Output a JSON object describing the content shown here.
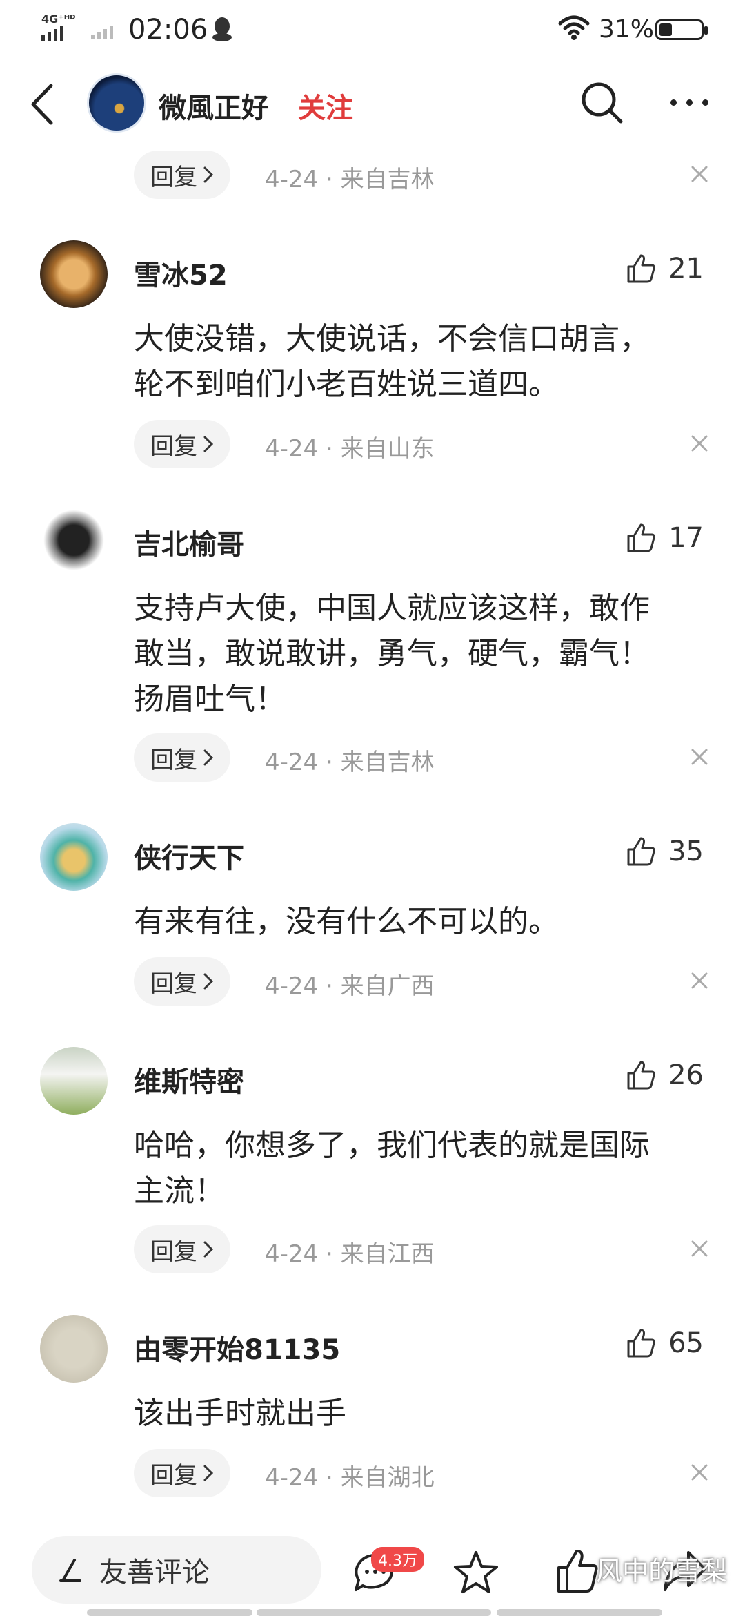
{
  "status_bar": {
    "network": "4G⁺ᴴᴰ",
    "time": "02:06",
    "battery": "31%",
    "battery_level": 0.31
  },
  "header": {
    "username": "微風正好",
    "follow_label": "关注"
  },
  "top_partial": {
    "reply_label": "回复",
    "meta": "4-24 · 来自吉林"
  },
  "comments": [
    {
      "user": "雪冰52",
      "likes": "21",
      "text": [
        "大使没错，大使说话，不会信口胡言，",
        "轮不到咱们小老百姓说三道四。"
      ],
      "reply_label": "回复",
      "meta": "4-24 · 来自山东"
    },
    {
      "user": "吉北榆哥",
      "likes": "17",
      "text": [
        "支持卢大使，中国人就应该这样，敢作",
        "敢当，敢说敢讲，勇气，硬气，霸气！",
        "扬眉吐气！"
      ],
      "reply_label": "回复",
      "meta": "4-24 · 来自吉林"
    },
    {
      "user": "侠行天下",
      "likes": "35",
      "text": [
        "有来有往，没有什么不可以的。"
      ],
      "reply_label": "回复",
      "meta": "4-24 · 来自广西"
    },
    {
      "user": "维斯特密",
      "likes": "26",
      "text": [
        "哈哈，你想多了，我们代表的就是国际",
        "主流！"
      ],
      "reply_label": "回复",
      "meta": "4-24 · 来自江西"
    },
    {
      "user": "由零开始81135",
      "likes": "65",
      "text": [
        "该出手时就出手"
      ],
      "reply_label": "回复",
      "meta": "4-24 · 来自湖北"
    }
  ],
  "bottom_bar": {
    "input_placeholder": "友善评论",
    "comment_count": "4.3万"
  },
  "watermark": "风中的雪梨",
  "icons": {
    "back": "chevron-left-icon",
    "search": "search-icon",
    "more": "more-dots-icon",
    "like": "thumbs-up-icon",
    "close": "close-icon",
    "pen": "pen-icon",
    "comment": "comment-bubble-icon",
    "star": "star-icon",
    "share": "share-icon"
  },
  "colors": {
    "follow": "#e03c3c",
    "meta_text": "#999999",
    "reply_bg": "#f3f3f3",
    "badge": "#f04848"
  }
}
